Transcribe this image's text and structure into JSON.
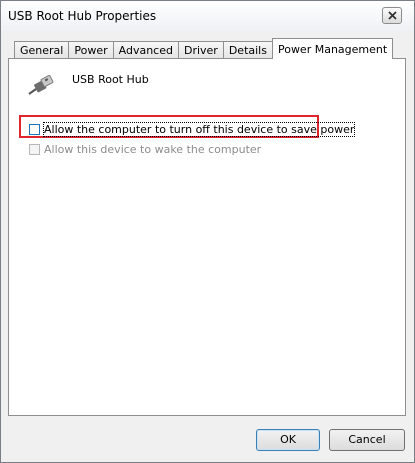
{
  "window": {
    "title": "USB Root Hub Properties"
  },
  "tabs": [
    {
      "label": "General"
    },
    {
      "label": "Power"
    },
    {
      "label": "Advanced"
    },
    {
      "label": "Driver"
    },
    {
      "label": "Details"
    },
    {
      "label": "Power Management",
      "active": true
    }
  ],
  "device": {
    "name": "USB Root Hub",
    "icon": "usb-plug-icon"
  },
  "options": [
    {
      "label": "Allow the computer to turn off this device to save power",
      "checked": false,
      "enabled": true,
      "highlighted": true
    },
    {
      "label": "Allow this device to wake the computer",
      "checked": false,
      "enabled": false
    }
  ],
  "buttons": {
    "ok": "OK",
    "cancel": "Cancel"
  },
  "colors": {
    "highlight": "#e0262d",
    "focus_border": "#1c75bc"
  }
}
